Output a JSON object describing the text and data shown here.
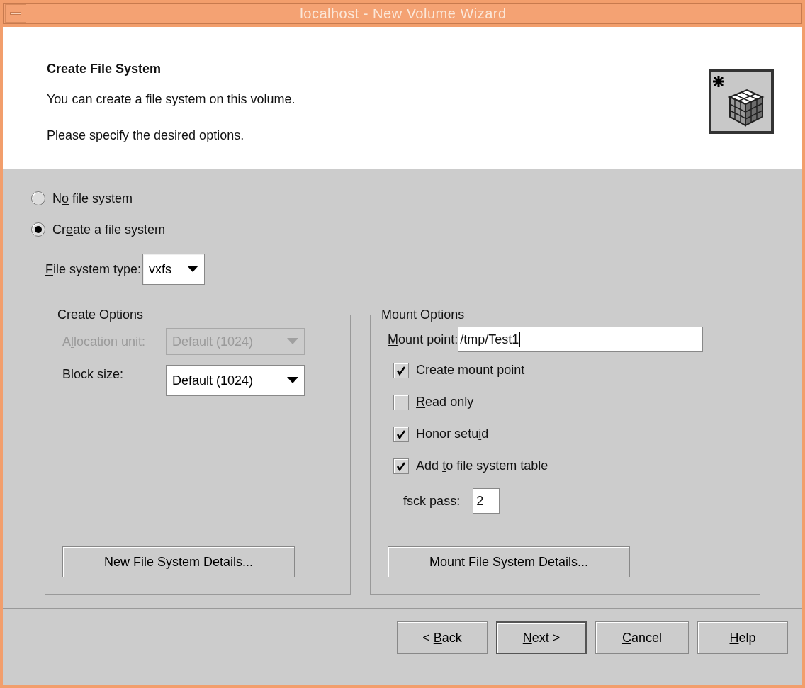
{
  "window": {
    "title": "localhost - New Volume Wizard"
  },
  "header": {
    "title": "Create File System",
    "lines": [
      "You can create a file system on this volume.",
      "Please specify the desired options."
    ]
  },
  "filesystem_choice": [
    {
      "label": {
        "pre": "N",
        "key": "o",
        "post": " file system"
      },
      "selected": false
    },
    {
      "label": {
        "pre": "Cr",
        "key": "e",
        "post": "ate a file system"
      },
      "selected": true
    }
  ],
  "filesystem_type": {
    "label": {
      "key": "F",
      "post": "ile system type:"
    },
    "value": "vxfs"
  },
  "create_options": {
    "title": "Create Options",
    "allocation_unit": {
      "label": {
        "pre": "A",
        "key": "l",
        "post": "location unit:"
      },
      "value": "Default (1024)",
      "disabled": true
    },
    "block_size": {
      "label": {
        "key": "B",
        "post": "lock size:"
      },
      "value": "Default (1024)",
      "disabled": false
    },
    "details_button": "New File System Details..."
  },
  "mount_options": {
    "title": "Mount Options",
    "mount_point": {
      "label": {
        "key": "M",
        "post": "ount point:"
      },
      "value": "/tmp/Test1"
    },
    "checkboxes": [
      {
        "label": {
          "pre": "Create mount ",
          "key": "p",
          "post": "oint"
        },
        "checked": true
      },
      {
        "label": {
          "key": "R",
          "post": "ead only"
        },
        "checked": false
      },
      {
        "label": {
          "pre": "Honor setu",
          "key": "i",
          "post": "d"
        },
        "checked": true
      },
      {
        "label": {
          "pre": "Add ",
          "key": "t",
          "post": "o file system table"
        },
        "checked": true
      }
    ],
    "fsck_pass": {
      "label": {
        "pre": "fsc",
        "key": "k",
        "post": " pass:"
      },
      "value": "2"
    },
    "details_button": "Mount File System Details..."
  },
  "buttons": [
    {
      "label": {
        "pre": "< ",
        "key": "B",
        "post": "ack"
      },
      "default": false
    },
    {
      "label": {
        "key": "N",
        "post": "ext >"
      },
      "default": true
    },
    {
      "label": {
        "key": "C",
        "post": "ancel"
      },
      "default": false
    },
    {
      "label": {
        "key": "H",
        "post": "elp"
      },
      "default": false
    }
  ]
}
